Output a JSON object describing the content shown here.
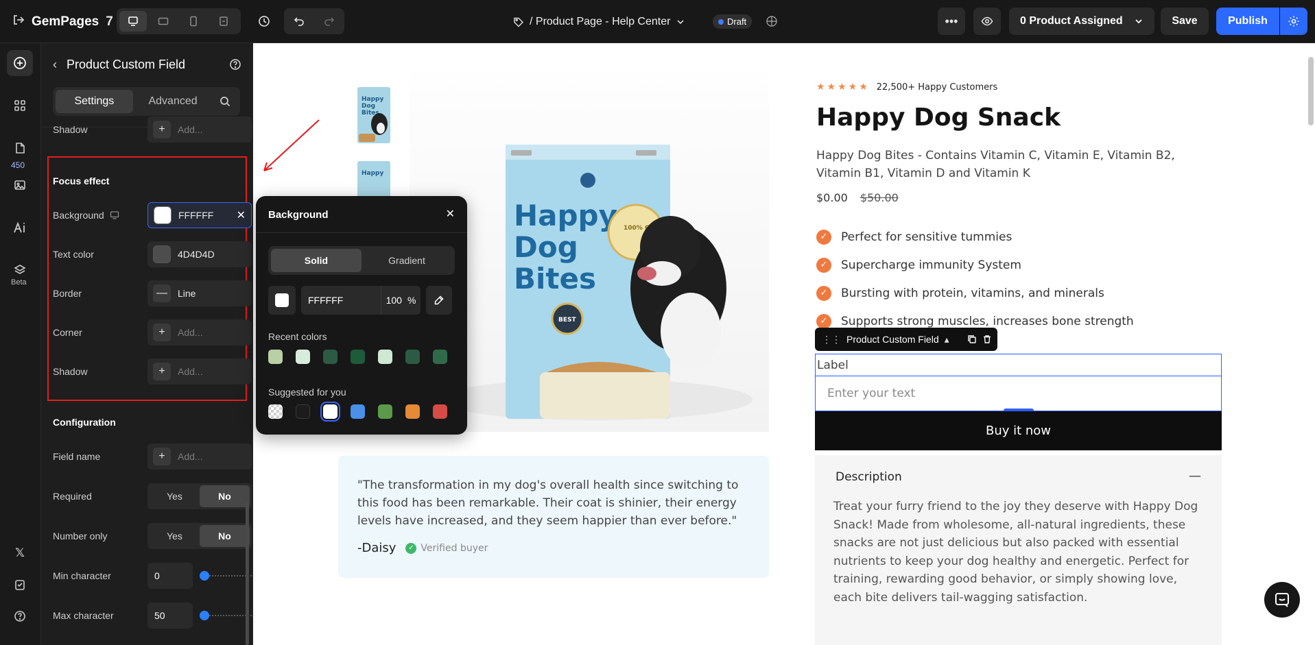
{
  "topbar": {
    "app_name": "GemPages",
    "app_version": "7",
    "page_title": "/ Product Page - Help Center",
    "status_badge": "Draft",
    "product_assigned": "0 Product Assigned",
    "save_label": "Save",
    "publish_label": "Publish"
  },
  "rail": {
    "badge_count": "450",
    "beta_label": "Beta"
  },
  "panel": {
    "title": "Product Custom Field",
    "tabs": [
      "Settings",
      "Advanced"
    ],
    "shadow_label_top": "Shadow",
    "add_placeholder": "Add...",
    "focus_section": {
      "title": "Focus effect",
      "background_label": "Background",
      "background_value": "FFFFFF",
      "text_color_label": "Text color",
      "text_color_value": "4D4D4D",
      "border_label": "Border",
      "border_value": "Line",
      "corner_label": "Corner",
      "shadow_label": "Shadow"
    },
    "config_section": {
      "title": "Configuration",
      "field_name_label": "Field name",
      "required_label": "Required",
      "number_only_label": "Number only",
      "yes": "Yes",
      "no": "No",
      "min_char_label": "Min character",
      "min_char_value": "0",
      "max_char_label": "Max character",
      "max_char_value": "50"
    }
  },
  "popover": {
    "title": "Background",
    "tabs": [
      "Solid",
      "Gradient"
    ],
    "hex_value": "FFFFFF",
    "opacity_value": "100",
    "opacity_unit": "%",
    "recent_label": "Recent colors",
    "recent_colors": [
      "#b9cfa6",
      "#d8ecdc",
      "#2d5a44",
      "#1f5a3a",
      "#cfe8d2",
      "#2d5a44",
      "#2f6b4a"
    ],
    "suggested_label": "Suggested for you",
    "suggested_colors": [
      "transparent",
      "#1c1c1c",
      "#ffffff",
      "#4a8fe8",
      "#5b9a4a",
      "#e58a35",
      "#d64b45"
    ]
  },
  "product": {
    "rating_text": "22,500+ Happy Customers",
    "title": "Happy Dog Snack",
    "description": "Happy Dog Bites - Contains Vitamin C, Vitamin E, Vitamin B2, Vitamin B1, Vitamin D and Vitamin K",
    "price": "$0.00",
    "compare_price": "$50.00",
    "benefits": [
      "Perfect for sensitive tummies",
      "Supercharge immunity System",
      "Bursting with protein, vitamins, and minerals",
      "Supports strong muscles, increases bone strength"
    ],
    "custom_field_tag": "Product Custom Field",
    "custom_field_label": "Label",
    "custom_field_placeholder": "Enter your text",
    "buy_label": "Buy it now",
    "desc_heading": "Description",
    "desc_body": "Treat your furry friend to the joy they deserve with Happy Dog Snack! Made from wholesome, all-natural ingredients, these snacks are not just delicious but also packed with essential nutrients to keep your dog healthy and energetic. Perfect for training, rewarding good behavior, or simply showing love, each bite delivers tail-wagging satisfaction.",
    "package_text": [
      "Happy",
      "Dog",
      "Bites"
    ],
    "package_badge": "BEST",
    "package_seal": "100% ORGANIC"
  },
  "testimonial": {
    "quote": "\"The transformation in my dog's overall health since switching to this food has been remarkable. Their coat is shinier, their energy levels have increased, and they seem happier than ever before.\"",
    "author": "-Daisy",
    "verified": "Verified buyer"
  },
  "colors": {
    "accent": "#2b69ff",
    "check_orange": "#ef7a3f",
    "highlight_red": "#e01e1e"
  }
}
